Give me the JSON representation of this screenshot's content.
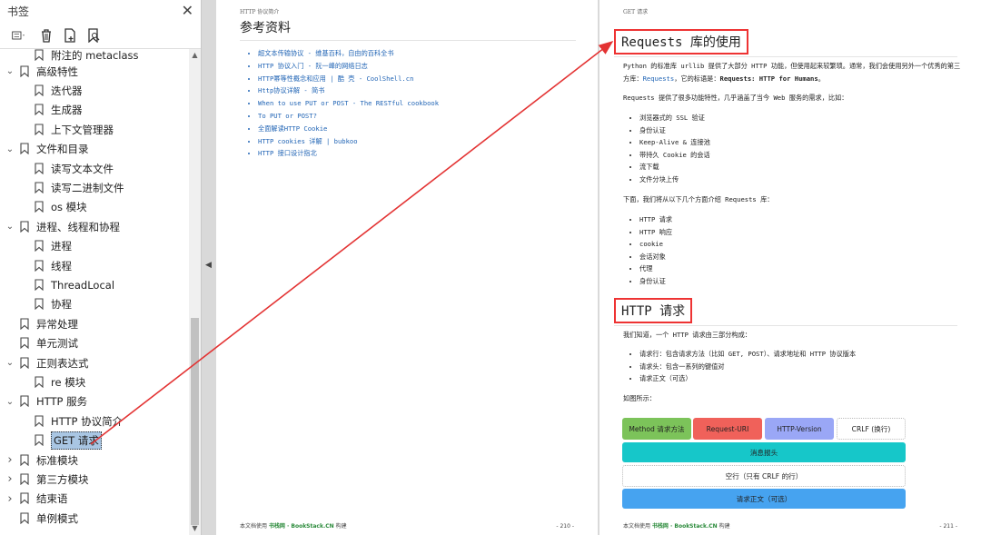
{
  "sidebar": {
    "title": "书签",
    "items": [
      {
        "label": "附注的 metaclass",
        "level": 1,
        "expandable": false
      },
      {
        "label": "高级特性",
        "level": 0,
        "expandable": true,
        "expanded": true
      },
      {
        "label": "迭代器",
        "level": 1,
        "expandable": false
      },
      {
        "label": "生成器",
        "level": 1,
        "expandable": false
      },
      {
        "label": "上下文管理器",
        "level": 1,
        "expandable": false
      },
      {
        "label": "文件和目录",
        "level": 0,
        "expandable": true,
        "expanded": true
      },
      {
        "label": "读写文本文件",
        "level": 1,
        "expandable": false
      },
      {
        "label": "读写二进制文件",
        "level": 1,
        "expandable": false
      },
      {
        "label": "os 模块",
        "level": 1,
        "expandable": false
      },
      {
        "label": "进程、线程和协程",
        "level": 0,
        "expandable": true,
        "expanded": true
      },
      {
        "label": "进程",
        "level": 1,
        "expandable": false
      },
      {
        "label": "线程",
        "level": 1,
        "expandable": false
      },
      {
        "label": "ThreadLocal",
        "level": 1,
        "expandable": false
      },
      {
        "label": "协程",
        "level": 1,
        "expandable": false
      },
      {
        "label": "异常处理",
        "level": 0,
        "expandable": false
      },
      {
        "label": "单元测试",
        "level": 0,
        "expandable": false
      },
      {
        "label": "正则表达式",
        "level": 0,
        "expandable": true,
        "expanded": true
      },
      {
        "label": "re 模块",
        "level": 1,
        "expandable": false
      },
      {
        "label": "HTTP 服务",
        "level": 0,
        "expandable": true,
        "expanded": true
      },
      {
        "label": "HTTP 协议简介",
        "level": 1,
        "expandable": false
      },
      {
        "label": "GET 请求",
        "level": 1,
        "expandable": false,
        "selected": true
      },
      {
        "label": "标准模块",
        "level": 0,
        "expandable": true,
        "expanded": false
      },
      {
        "label": "第三方模块",
        "level": 0,
        "expandable": true,
        "expanded": false
      },
      {
        "label": "结束语",
        "level": 0,
        "expandable": true,
        "expanded": false
      },
      {
        "label": "单例模式",
        "level": 0,
        "expandable": false
      }
    ]
  },
  "left_page": {
    "running_head": "HTTP 协议简介",
    "title": "参考资料",
    "refs": [
      "超文本传输协议 - 维基百科，自由的百科全书",
      "HTTP 协议入门 - 阮一峰的网络日志",
      "HTTP幂等性概念和应用 | 酷 壳 - CoolShell.cn",
      "Http协议详解 - 简书",
      "When to use PUT or POST - The RESTful cookbook",
      "To PUT or POST?",
      "全面解读HTTP Cookie",
      "HTTP cookies 详解 | bubkoo",
      "HTTP 接口设计指北"
    ],
    "footer_prefix": "本文档使用 ",
    "footer_brand": "书栈网 · BookStack.CN",
    "footer_suffix": " 构建",
    "page_number": "- 210 -"
  },
  "right_page": {
    "running_head": "GET 请求",
    "section1_title": "Requests 库的使用",
    "p1_a": "Python 的标准库 urllib 提供了大部分 HTTP 功能，但使用起来较繁琐。通常，我们会使用另外一个优秀的第三方库：",
    "p1_link": "Requests",
    "p1_b": "，它的标语是：",
    "p1_bold": "Requests: HTTP for Humans",
    "p1_c": "。",
    "p2": "Requests 提供了很多功能特性，几乎涵盖了当今 Web 服务的需求，比如：",
    "features": [
      "浏览器式的 SSL 验证",
      "身份认证",
      "Keep-Alive & 连接池",
      "带持久 Cookie 的会话",
      "流下载",
      "文件分块上传"
    ],
    "p3": "下面，我们将从以下几个方面介绍 Requests 库：",
    "topics": [
      "HTTP 请求",
      "HTTP 响应",
      "cookie",
      "会话对象",
      "代理",
      "身份认证"
    ],
    "section2_title": "HTTP 请求",
    "p4": "我们知道，一个 HTTP 请求由三部分构成：",
    "parts": [
      "请求行：包含请求方法（比如 GET, POST）、请求地址和 HTTP 协议版本",
      "请求头：包含一系列的键值对",
      "请求正文（可选）"
    ],
    "p5": "如图所示：",
    "diagram": {
      "method": "Method 请求方法",
      "uri": "Request-URI",
      "version": "HTTP-Version",
      "crlf": "CRLF (换行)",
      "header": "消息报头",
      "blank": "空行（只有 CRLF 的行）",
      "body": "请求正文（可选）"
    },
    "footer_prefix": "本文档使用 ",
    "footer_brand": "书栈网 · BookStack.CN",
    "footer_suffix": " 构建",
    "page_number": "- 211 -"
  },
  "colors": {
    "highlight_box": "#e33333",
    "arrow": "#e33333",
    "selected_bg": "#a9c6e3",
    "link": "#2366b6",
    "method_box": "#7cc35a",
    "uri_box": "#f0615a",
    "version_box": "#9aa7f6",
    "header_box": "#16c7c9",
    "body_box": "#46a3f0"
  },
  "icons": [
    "close-icon",
    "options-menu-icon",
    "delete-bookmark-icon",
    "add-bookmark-icon",
    "find-bookmark-icon",
    "bookmark-icon",
    "chevron-down-icon",
    "chevron-right-icon",
    "collapse-arrow-icon"
  ]
}
